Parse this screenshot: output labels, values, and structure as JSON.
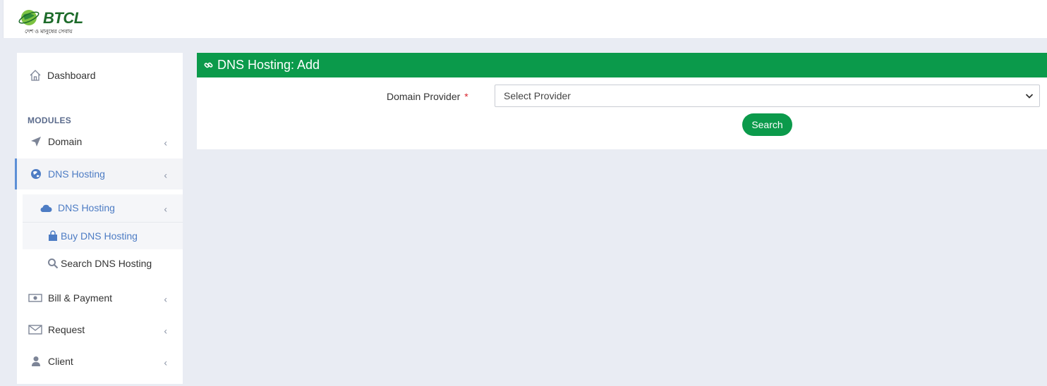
{
  "brand": {
    "name": "BTCL",
    "tagline": "দেশ ও মানুষের সেবায়",
    "accent": "#0b9a4b"
  },
  "sidebar": {
    "dashboard_label": "Dashboard",
    "modules_label": "MODULES",
    "items": [
      {
        "label": "Domain",
        "icon": "paper-plane-icon"
      },
      {
        "label": "DNS Hosting",
        "icon": "globe-icon",
        "active": true
      },
      {
        "label": "Bill & Payment",
        "icon": "money-icon"
      },
      {
        "label": "Request",
        "icon": "envelope-icon"
      },
      {
        "label": "Client",
        "icon": "user-icon"
      }
    ],
    "submenu": {
      "label": "DNS Hosting",
      "icon": "cloud-icon",
      "children": [
        {
          "label": "Buy DNS Hosting",
          "icon": "shopping-bag-icon",
          "active": true
        },
        {
          "label": "Search DNS Hosting",
          "icon": "search-icon"
        }
      ]
    }
  },
  "main": {
    "panel_title": "DNS Hosting: Add",
    "form": {
      "domain_provider_label": "Domain Provider",
      "required_mark": "*",
      "provider_selected": "Select Provider",
      "search_button": "Search"
    }
  }
}
